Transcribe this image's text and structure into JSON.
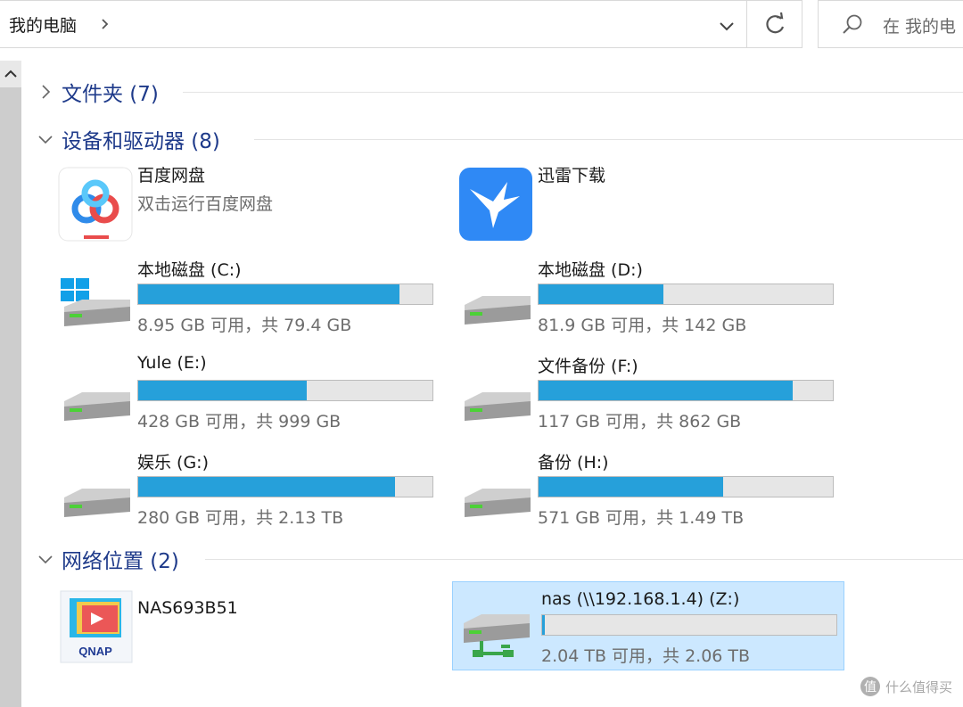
{
  "address": {
    "path": "我的电脑"
  },
  "search": {
    "placeholder": "在 我的电"
  },
  "groups": [
    {
      "title": "文件夹 (7)",
      "expanded": false
    },
    {
      "title": "设备和驱动器 (8)",
      "expanded": true
    },
    {
      "title": "网络位置 (2)",
      "expanded": true
    }
  ],
  "apps": [
    {
      "name": "百度网盘",
      "subtitle": "双击运行百度网盘",
      "icon": "baidu-netdisk-icon"
    },
    {
      "name": "迅雷下载",
      "icon": "thunder-download-icon"
    }
  ],
  "drives": [
    {
      "name": "本地磁盘 (C:)",
      "free": "8.95 GB 可用，共 79.4 GB",
      "used_fraction": 0.887,
      "icon": "system-drive-icon"
    },
    {
      "name": "本地磁盘 (D:)",
      "free": "81.9 GB 可用，共 142 GB",
      "used_fraction": 0.423,
      "icon": "drive-icon"
    },
    {
      "name": "Yule (E:)",
      "free": "428 GB 可用，共 999 GB",
      "used_fraction": 0.572,
      "icon": "drive-icon"
    },
    {
      "name": "文件备份 (F:)",
      "free": "117 GB 可用，共 862 GB",
      "used_fraction": 0.864,
      "icon": "drive-icon"
    },
    {
      "name": "娱乐 (G:)",
      "free": "280 GB 可用，共 2.13 TB",
      "used_fraction": 0.872,
      "icon": "drive-icon"
    },
    {
      "name": "备份 (H:)",
      "free": "571 GB 可用，共 1.49 TB",
      "used_fraction": 0.626,
      "icon": "drive-icon"
    }
  ],
  "network": [
    {
      "name": "NAS693B51",
      "icon": "qnap-icon"
    },
    {
      "name": "nas (\\\\192.168.1.4) (Z:)",
      "free": "2.04 TB 可用，共 2.06 TB",
      "used_fraction": 0.01,
      "icon": "network-drive-icon",
      "selected": true
    }
  ],
  "watermark": {
    "mark": "值",
    "text": "什么值得买"
  },
  "colors": {
    "bar_fill": "#26a0da",
    "bar_bg": "#e6e6e6",
    "group_title": "#1e3a8a",
    "selection": "#cce8ff"
  }
}
